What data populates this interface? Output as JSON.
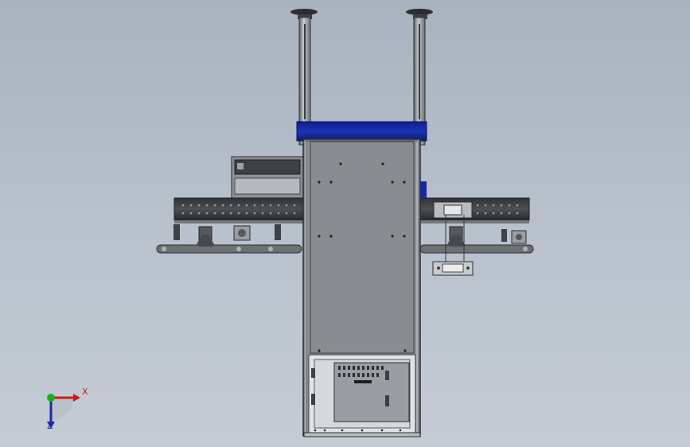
{
  "viewport": {
    "background_top": "#a9b3bf",
    "background_bottom": "#c5ccd6"
  },
  "triad": {
    "x_label": "X",
    "z_label": "Z",
    "x_color": "#d01818",
    "y_color": "#18b018",
    "z_color": "#1a2aa8"
  },
  "colors": {
    "frame_gray": "#8a8d91",
    "frame_dark": "#3a3d41",
    "accent_blue": "#1428a0",
    "panel_light": "#e2e4e6"
  }
}
